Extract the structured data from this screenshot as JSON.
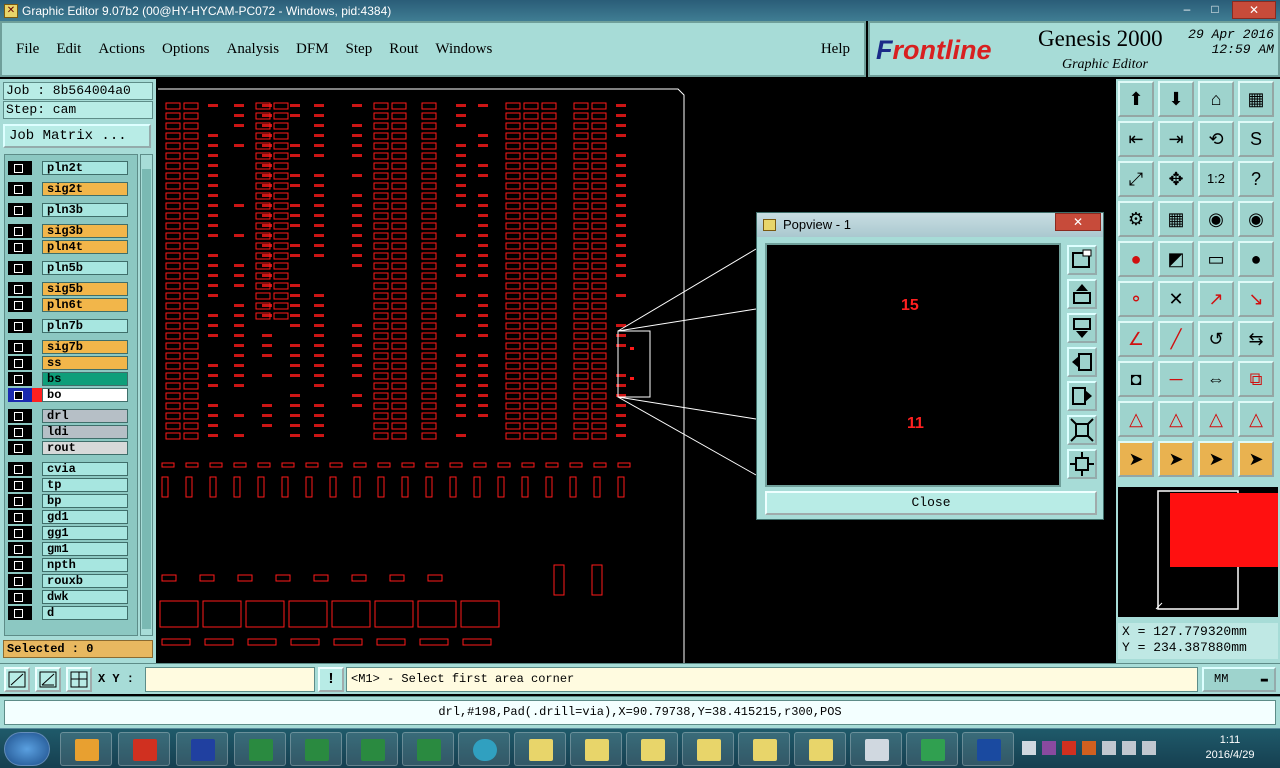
{
  "window": {
    "title": "Graphic Editor 9.07b2 (00@HY-HYCAM-PC072 - Windows, pid:4384)",
    "controls": [
      "–",
      "□",
      "✕"
    ]
  },
  "menu": {
    "items": [
      "File",
      "Edit",
      "Actions",
      "Options",
      "Analysis",
      "DFM",
      "Step",
      "Rout",
      "Windows"
    ],
    "help": "Help"
  },
  "brand": {
    "logo_prefix": "F",
    "logo_rest": "rontline",
    "product": "Genesis 2000",
    "subtitle": "Graphic Editor",
    "date": "29 Apr 2016",
    "time": "12:59 AM"
  },
  "job": {
    "job_label": "Job : 8b564004a0",
    "step_label": "Step: cam",
    "matrix_button": "Job Matrix ..."
  },
  "layers": [
    {
      "name": "pln2t",
      "color": "#a7e6e0"
    },
    {
      "name": "sig2t",
      "color": "#f2b64a"
    },
    {
      "name": "pln3b",
      "color": "#a7e6e0"
    },
    {
      "name": "sig3b",
      "color": "#f2b64a"
    },
    {
      "name": "pln4t",
      "color": "#f2b64a"
    },
    {
      "name": "pln5b",
      "color": "#a7e6e0"
    },
    {
      "name": "sig5b",
      "color": "#f2b64a"
    },
    {
      "name": "pln6t",
      "color": "#f2b64a"
    },
    {
      "name": "pln7b",
      "color": "#a7e6e0"
    },
    {
      "name": "sig7b",
      "color": "#f2b64a"
    },
    {
      "name": "ss",
      "color": "#f2b64a"
    },
    {
      "name": "bs",
      "color": "#0e9e7a"
    },
    {
      "name": "bo",
      "color": "#ffffff"
    },
    {
      "name": "drl",
      "color": "#b6bfc6"
    },
    {
      "name": "ldi",
      "color": "#b6bfc6"
    },
    {
      "name": "rout",
      "color": "#d7d9d9"
    },
    {
      "name": "cvia",
      "color": "#a7e6e0"
    },
    {
      "name": "tp",
      "color": "#a7e6e0"
    },
    {
      "name": "bp",
      "color": "#a7e6e0"
    },
    {
      "name": "gd1",
      "color": "#a7e6e0"
    },
    {
      "name": "gg1",
      "color": "#a7e6e0"
    },
    {
      "name": "gm1",
      "color": "#a7e6e0"
    },
    {
      "name": "npth",
      "color": "#a7e6e0"
    },
    {
      "name": "rouxb",
      "color": "#a7e6e0"
    },
    {
      "name": "dwk",
      "color": "#a7e6e0"
    },
    {
      "name": "d",
      "color": "#a7e6e0"
    }
  ],
  "selected": "Selected : 0",
  "popview": {
    "title": "Popview - 1",
    "value_top": "15",
    "value_bottom": "11",
    "close_label": "Close"
  },
  "coords": {
    "x": "X = 127.779320mm",
    "y": "Y = 234.387880mm"
  },
  "command": {
    "xy_label": "X Y :",
    "xy_value": "",
    "warn": "!",
    "prompt": "<M1> - Select first area corner",
    "units": "MM"
  },
  "status_text": "drl,#198,Pad(.drill=via),X=90.79738,Y=38.415215,r300,POS",
  "taskbar": {
    "time": "1:11",
    "date": "2016/4/29"
  },
  "colors": {
    "panel": "#a7dcd7",
    "features": "#ff1a1a",
    "highlight": "#f2b64a"
  }
}
